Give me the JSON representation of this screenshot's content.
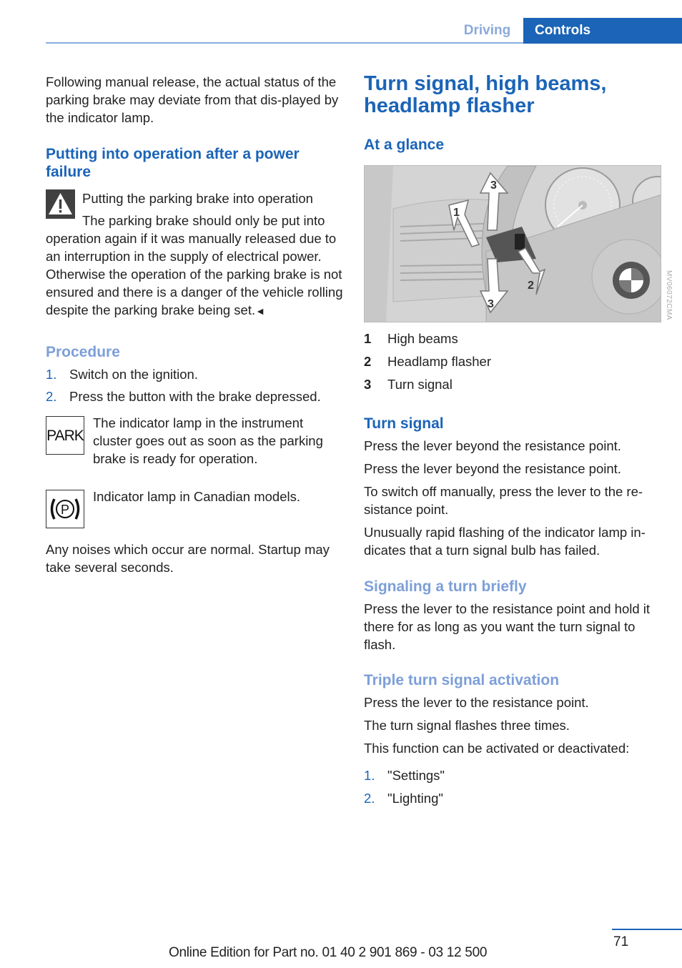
{
  "header": {
    "section": "Driving",
    "chapter": "Controls",
    "colors": {
      "accent": "#1b64b7",
      "light_accent": "#8ba9da"
    }
  },
  "left": {
    "intro": "Following manual release, the actual status of the parking brake may deviate from that dis-played by the indicator lamp.",
    "power_failure_heading": "Putting into operation after a power failure",
    "warning": {
      "icon": "warning-triangle-icon",
      "title": "Putting the parking brake into operation",
      "body": "The parking brake should only be put into operation again if it was manually released due to an interruption in the supply of electrical power. Otherwise the operation of the parking brake is not ensured and there is a danger of the vehicle rolling despite the parking brake being set.",
      "end_mark": "◄"
    },
    "procedure_heading": "Procedure",
    "procedure_steps": [
      {
        "num": "1.",
        "text": "Switch on the ignition."
      },
      {
        "num": "2.",
        "text": "Press the button with the brake depressed."
      }
    ],
    "park_lamp": {
      "icon_label": "PARK",
      "text": "The indicator lamp in the instrument cluster goes out as soon as the parking brake is ready for operation."
    },
    "canada_lamp": {
      "icon": "parking-brake-circle-icon",
      "text": "Indicator lamp in Canadian models."
    },
    "noises": "Any noises which occur are normal. Startup may take several seconds."
  },
  "right": {
    "title": "Turn signal, high beams, headlamp flasher",
    "at_a_glance": "At a glance",
    "figure": {
      "code": "MV06072CMA",
      "callouts": [
        "1",
        "2",
        "3",
        "3"
      ],
      "emblem": "BMW"
    },
    "legend": [
      {
        "num": "1",
        "text": "High beams"
      },
      {
        "num": "2",
        "text": "Headlamp flasher"
      },
      {
        "num": "3",
        "text": "Turn signal"
      }
    ],
    "turn_signal_heading": "Turn signal",
    "turn_signal_paras": [
      "Press the lever beyond the resistance point.",
      "Press the lever beyond the resistance point.",
      "To switch off manually, press the lever to the re-sistance point.",
      "Unusually rapid flashing of the indicator lamp in-dicates that a turn signal bulb has failed."
    ],
    "briefly_heading": "Signaling a turn briefly",
    "briefly_text": "Press the lever to the resistance point and hold it there for as long as you want the turn signal to flash.",
    "triple_heading": "Triple turn signal activation",
    "triple_paras": [
      "Press the lever to the resistance point.",
      "The turn signal flashes three times.",
      "This function can be activated or deactivated:"
    ],
    "triple_steps": [
      {
        "num": "1.",
        "text": "\"Settings\""
      },
      {
        "num": "2.",
        "text": "\"Lighting\""
      }
    ]
  },
  "footer": {
    "page_number": "71",
    "edition": "Online Edition for Part no. 01 40 2 901 869 - 03 12 500"
  }
}
